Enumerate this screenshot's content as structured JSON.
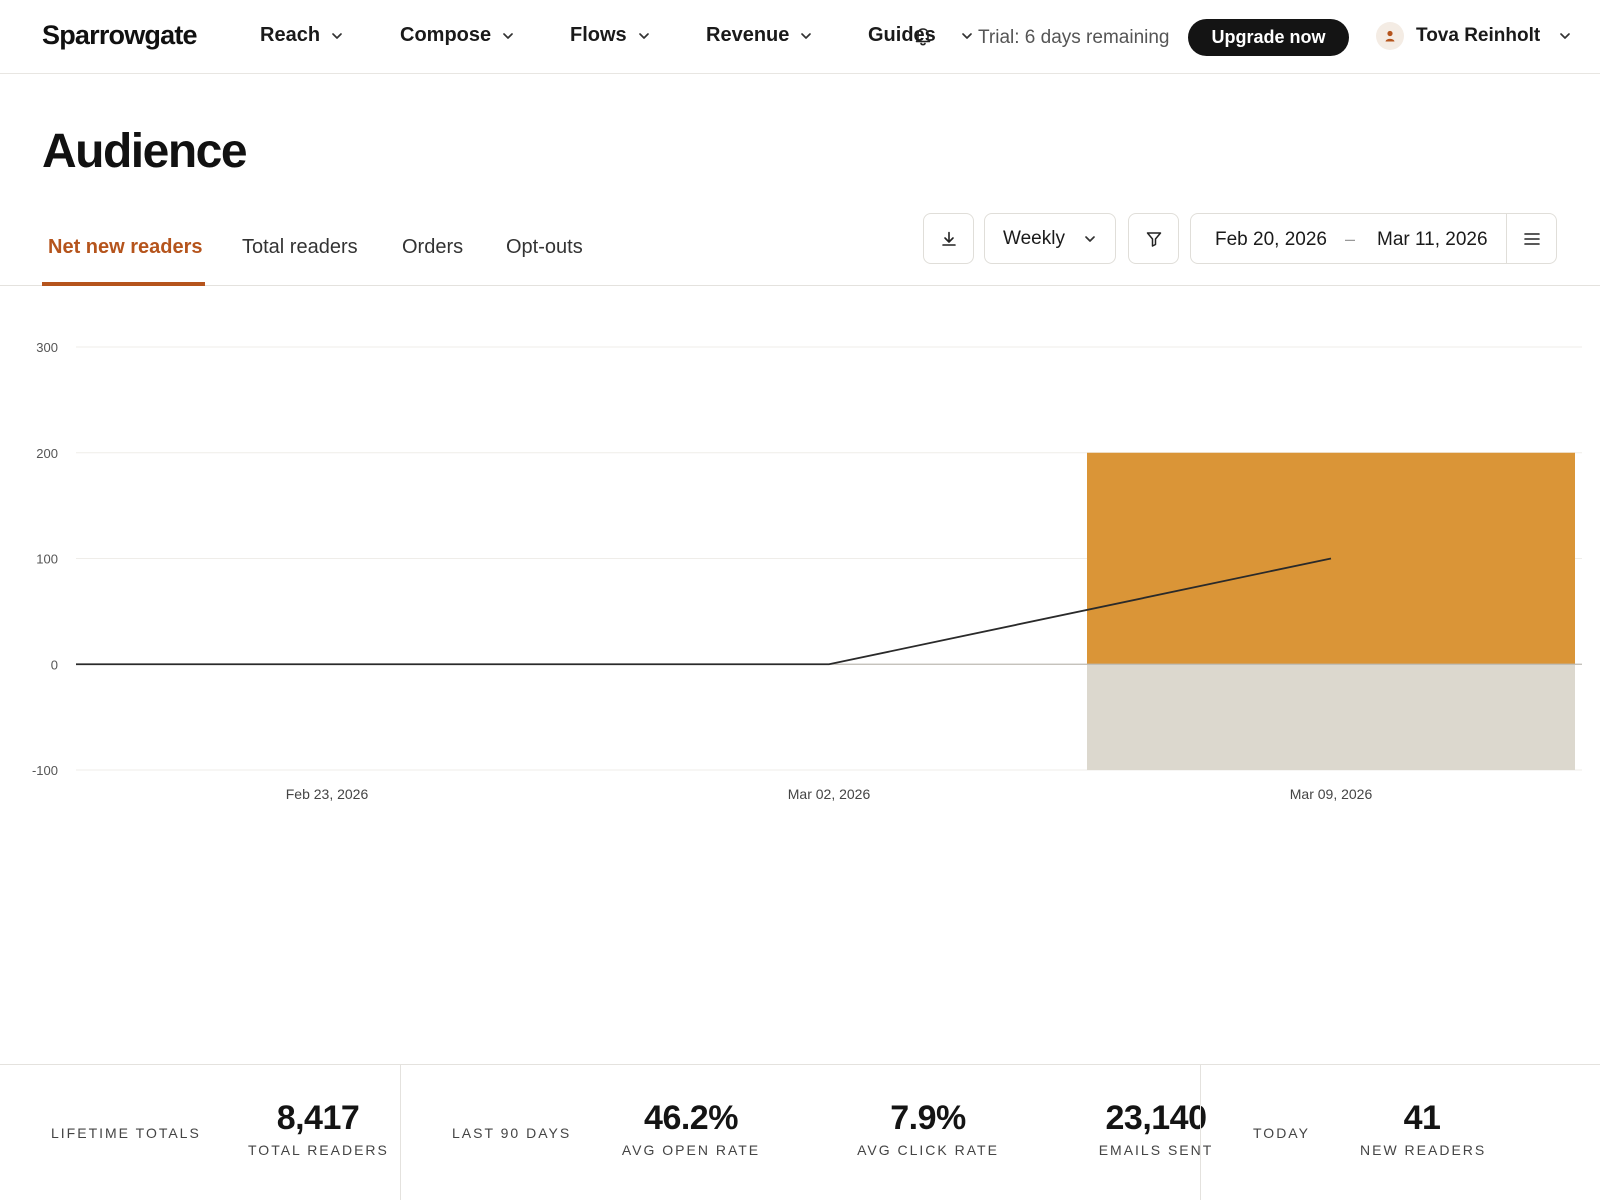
{
  "app": {
    "logo": "Sparrowgate"
  },
  "nav": {
    "items": [
      {
        "label": "Reach"
      },
      {
        "label": "Compose"
      },
      {
        "label": "Flows"
      },
      {
        "label": "Revenue"
      },
      {
        "label": "Guides"
      }
    ],
    "trial_text": "Trial: 6 days remaining",
    "upgrade_label": "Upgrade now",
    "user_name": "Tova Reinholt"
  },
  "page": {
    "title": "Audience"
  },
  "tabs": [
    {
      "label": "Net new readers",
      "active": true
    },
    {
      "label": "Total readers",
      "active": false
    },
    {
      "label": "Orders",
      "active": false
    },
    {
      "label": "Opt-outs",
      "active": false
    }
  ],
  "toolbar": {
    "interval": "Weekly",
    "date_start": "Feb 20, 2026",
    "date_separator": "–",
    "date_end": "Mar 11, 2026"
  },
  "colors": {
    "accent": "#b5541c",
    "bar_positive": "#da9537",
    "bar_negative": "#dcd8ce",
    "line": "#2a2a2a"
  },
  "icons": {
    "nav": "chevron-down-icon",
    "notifications": "bell-icon",
    "avatar": "user-icon",
    "download": "download-icon",
    "filter": "filter-icon",
    "menu": "hamburger-menu-icon"
  },
  "chart_data": {
    "type": "bar",
    "x_labels": [
      "Feb 23, 2026",
      "Mar 02, 2026",
      "Mar 09, 2026"
    ],
    "series": [
      {
        "values": [
          0,
          0,
          200
        ]
      },
      {
        "values": [
          0,
          0,
          -100
        ]
      },
      {
        "values": [
          0,
          0,
          100
        ]
      }
    ],
    "y_ticks": [
      300,
      200,
      100,
      0,
      -100
    ],
    "ylim": [
      -100,
      300
    ],
    "grid": true
  },
  "stats": {
    "lifetime": {
      "label": "LIFETIME TOTALS",
      "metrics": [
        {
          "value": "8,417",
          "label": "TOTAL READERS"
        }
      ]
    },
    "last90": {
      "label": "LAST 90 DAYS",
      "metrics": [
        {
          "value": "46.2%",
          "label": "AVG OPEN RATE"
        },
        {
          "value": "7.9%",
          "label": "AVG CLICK RATE"
        },
        {
          "value": "23,140",
          "label": "EMAILS SENT"
        }
      ]
    },
    "today": {
      "label": "TODAY",
      "metrics": [
        {
          "value": "41",
          "label": "NEW READERS"
        }
      ]
    }
  }
}
